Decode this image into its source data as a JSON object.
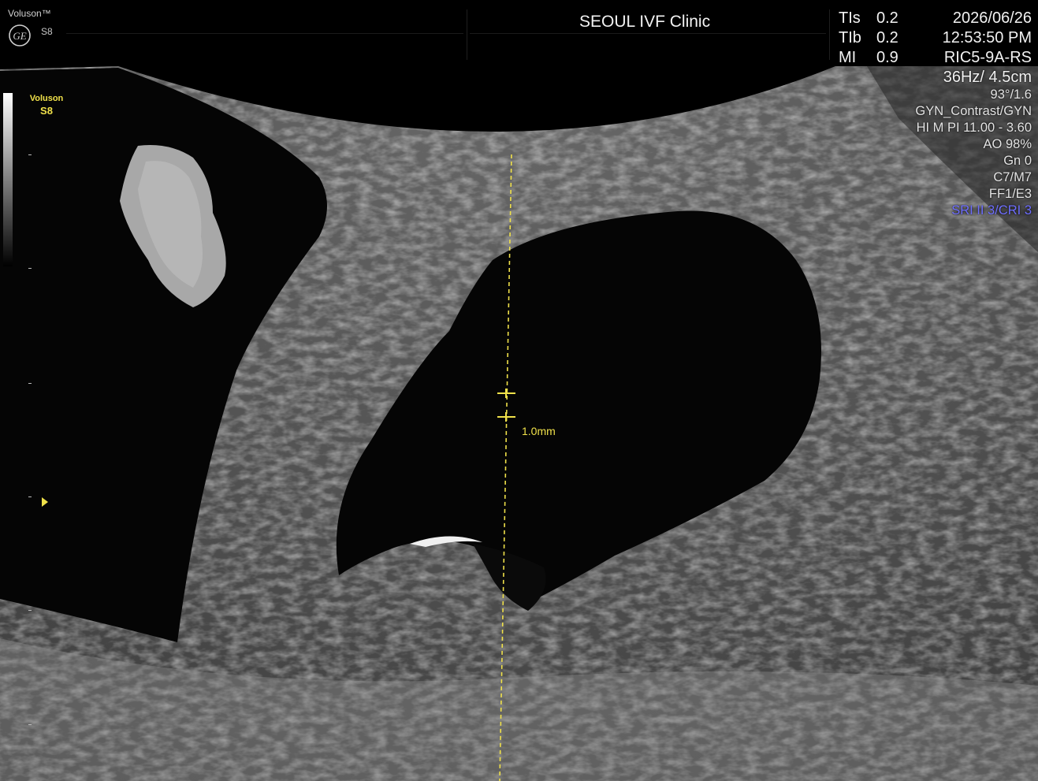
{
  "header": {
    "brand": "Voluson™",
    "model": "S8",
    "clinic": "SEOUL IVF Clinic",
    "indices": [
      {
        "label": "TIs",
        "value": "0.2"
      },
      {
        "label": "TIb",
        "value": "0.2"
      },
      {
        "label": "MI",
        "value": "0.9"
      }
    ],
    "date": "2026/06/26",
    "time": "12:53:50 PM",
    "probe": "RIC5-9A-RS"
  },
  "parameters": {
    "frame_depth": "36Hz/ 4.5cm",
    "angle": "93°/1.6",
    "preset": "GYN_Contrast/GYN",
    "harmonic": "HI M PI 11.00 - 3.60",
    "ao": "AO 98%",
    "gain": "Gn   0",
    "cm": "C7/M7",
    "ff": "FF1/E3",
    "sri": "SRI II 3/CRI 3"
  },
  "image_overlay": {
    "mini_brand": "Voluson",
    "mini_model": "S8",
    "measurement": "1.0mm"
  },
  "colors": {
    "accent_yellow": "#f0e14a",
    "sri_blue": "#6f6fff",
    "text": "#f2f2f2",
    "background": "#000000"
  },
  "icons": [
    "ge-logo-icon",
    "focus-marker-icon"
  ]
}
